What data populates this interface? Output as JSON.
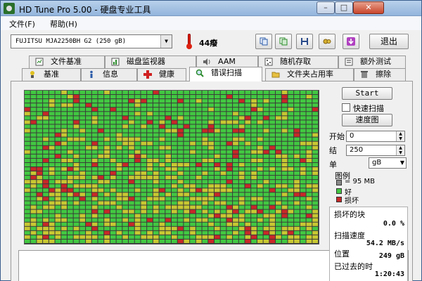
{
  "window": {
    "title": "HD Tune Pro 5.00 - 硬盘专业工具"
  },
  "menu": {
    "file": "文件(F)",
    "help": "帮助(H)"
  },
  "toolbar": {
    "drive": "FUJITSU MJA2250BH G2 (250 gB)",
    "temperature": "44癈",
    "exit_label": "退出",
    "tool_icons": [
      "copy-text-icon",
      "copy-screenshot-icon",
      "save-icon",
      "options-icon",
      "download-icon"
    ]
  },
  "tabs": {
    "row1": [
      "文件基准",
      "磁盘监视器",
      "AAM",
      "随机存取",
      "额外测试"
    ],
    "row2": [
      "基准",
      "信息",
      "健康",
      "错误扫描",
      "文件夹占用率",
      "擦除"
    ],
    "active": "错误扫描"
  },
  "controls": {
    "start_label": "Start",
    "quick_scan_label": "快速扫描",
    "quick_scan_checked": false,
    "map_label": "速度图",
    "start_field_label": "开始",
    "start_value": "0",
    "end_field_label": "结",
    "end_value": "250",
    "unit_label": "单",
    "unit_value": "gB"
  },
  "legend": {
    "title": "图例",
    "block_size": "= 95 MB",
    "good_label": "好",
    "bad_label": "损坏"
  },
  "stats": {
    "damaged_label": "损坏的块",
    "damaged_value": "0.0 %",
    "speed_label": "扫描速度",
    "speed_value": "54.2 MB/s",
    "position_label": "位置",
    "position_value": "249 gB",
    "elapsed_label": "已过去的时",
    "elapsed_value": "1:20:43"
  },
  "colors": {
    "good": "#42c842",
    "amber": "#c8c832",
    "bad": "#c82828",
    "grid_line": "#3a3a3a"
  }
}
